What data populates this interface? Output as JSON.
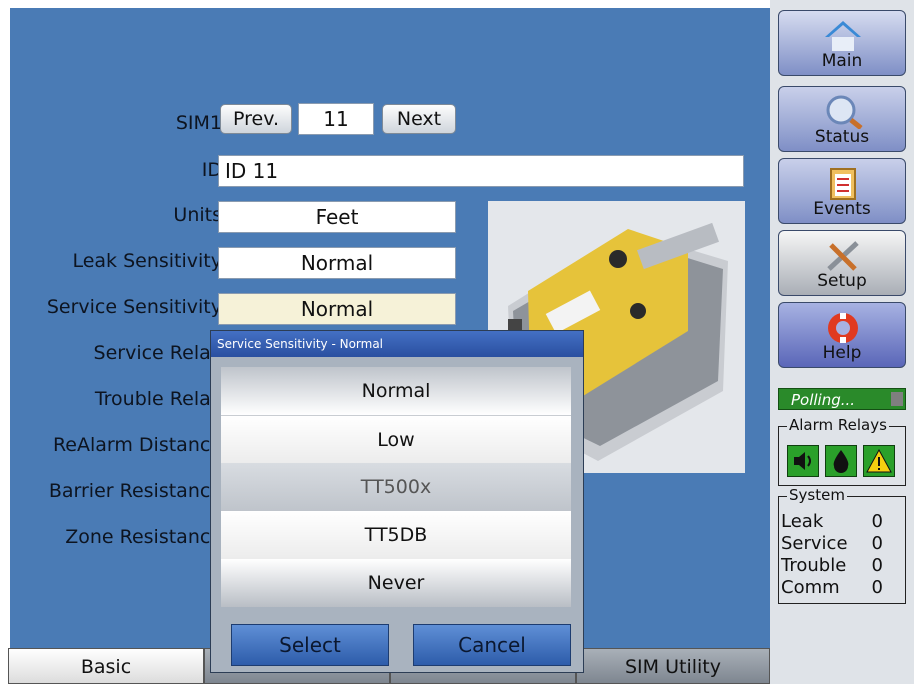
{
  "form": {
    "sim_label": "SIM1",
    "prev_label": "Prev.",
    "sim_number": "11",
    "next_label": "Next",
    "id_label": "ID",
    "id_value": "ID 11",
    "units_label": "Units",
    "units_value": "Feet",
    "leak_sensitivity_label": "Leak Sensitivity",
    "leak_sensitivity_value": "Normal",
    "service_sensitivity_label": "Service Sensitivity",
    "service_sensitivity_value": "Normal",
    "service_relay_label": "Service Relay",
    "trouble_relay_label": "Trouble Relay",
    "realarm_label": "ReAlarm Distance",
    "barrier_label": "Barrier Resistance",
    "zone_label": "Zone Resistance"
  },
  "popup": {
    "title": "Service Sensitivity - Normal",
    "options": [
      "Normal",
      "Low",
      "TT500x",
      "TT5DB",
      "Never"
    ],
    "selected_option": "TT500x",
    "select_label": "Select",
    "cancel_label": "Cancel"
  },
  "tabs": [
    {
      "label": "Basic",
      "active": true
    },
    {
      "label": "",
      "active": false
    },
    {
      "label": "",
      "active": false
    },
    {
      "label": "SIM Utility",
      "active": false
    }
  ],
  "nav": {
    "main": "Main",
    "status": "Status",
    "events": "Events",
    "setup": "Setup",
    "help": "Help"
  },
  "status_panel": {
    "polling": "Polling...",
    "alarm_relays_title": "Alarm Relays",
    "alarm_relay_icons": [
      "speaker-icon",
      "drop-icon",
      "warning-icon"
    ],
    "system_title": "System",
    "system_rows": [
      {
        "label": "Leak",
        "value": "0"
      },
      {
        "label": "Service",
        "value": "0"
      },
      {
        "label": "Trouble",
        "value": "0"
      },
      {
        "label": "Comm",
        "value": "0"
      }
    ]
  },
  "colors": {
    "background": "#4a7bb5",
    "side_panel": "#dfe3e8",
    "popup_title": "#2a4fa0",
    "polling": "#2a8a2a"
  }
}
